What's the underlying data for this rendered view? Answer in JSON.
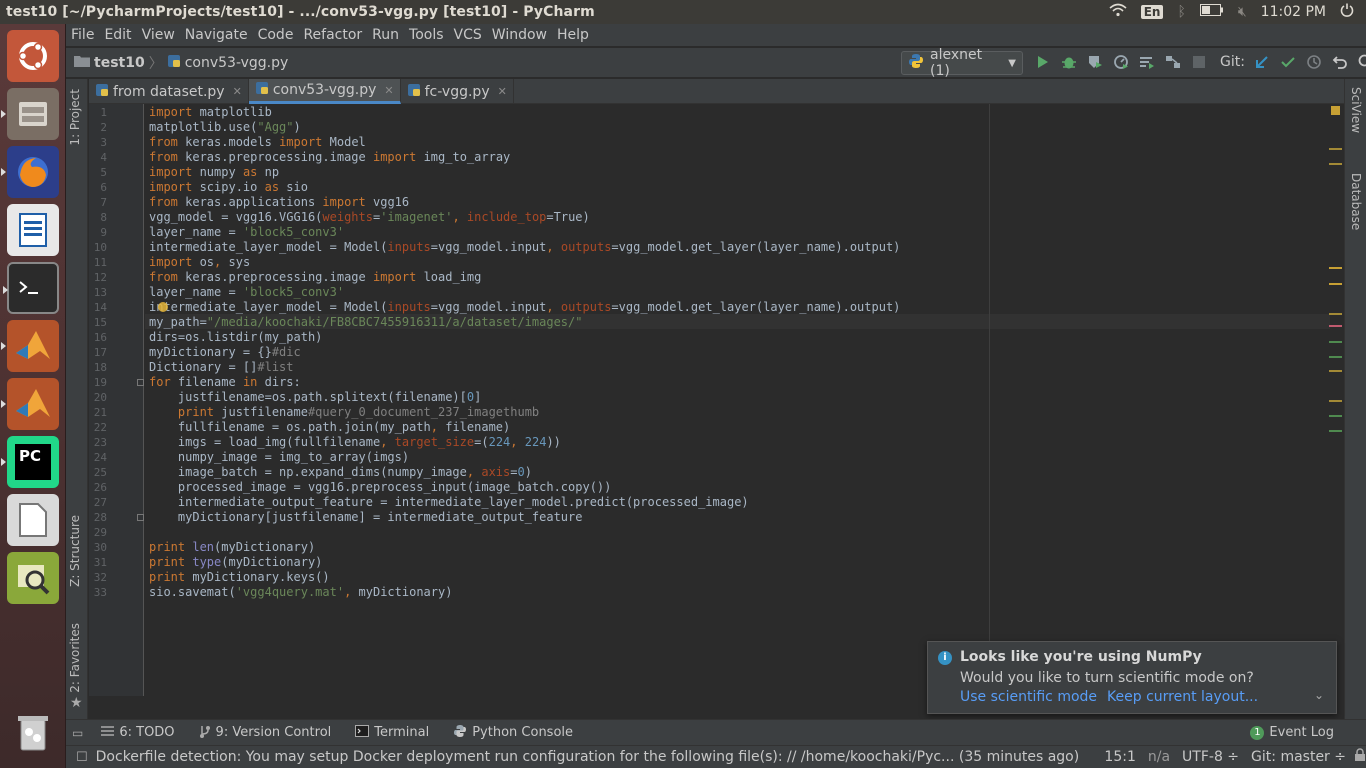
{
  "os": {
    "window_title": "test10 [~/PycharmProjects/test10] - .../conv53-vgg.py [test10] - PyCharm",
    "keyboard_lang": "En",
    "clock": "11:02 PM"
  },
  "launcher": {
    "items": [
      "ubuntu-dash-icon",
      "files-icon",
      "firefox-icon",
      "writer-icon",
      "terminal-icon",
      "matlab-icon",
      "matlab-icon",
      "pycharm-icon",
      "libreoffice-icon",
      "image-viewer-icon",
      "trash-icon"
    ]
  },
  "menu": [
    "File",
    "Edit",
    "View",
    "Navigate",
    "Code",
    "Refactor",
    "Run",
    "Tools",
    "VCS",
    "Window",
    "Help"
  ],
  "navbar": {
    "project": "test10",
    "file": "conv53-vgg.py",
    "run_config": "alexnet (1)",
    "git_label": "Git:"
  },
  "tabs": [
    {
      "label": "from dataset.py"
    },
    {
      "label": "conv53-vgg.py"
    },
    {
      "label": "fc-vgg.py"
    }
  ],
  "side_panels": {
    "left_top": "1: Project",
    "left_mid": "Z: Structure",
    "left_bottom": "2: Favorites",
    "right_top": "SciView",
    "right_mid": "Database"
  },
  "line_numbers": [
    "1",
    "2",
    "3",
    "4",
    "5",
    "6",
    "7",
    "8",
    "9",
    "10",
    "11",
    "12",
    "13",
    "14",
    "15",
    "16",
    "17",
    "18",
    "19",
    "20",
    "21",
    "22",
    "23",
    "24",
    "25",
    "26",
    "27",
    "28",
    "29",
    "30",
    "31",
    "32",
    "33"
  ],
  "code_lines": [
    "import matplotlib",
    "matplotlib.use(\"Agg\")",
    "from keras.models import Model",
    "from keras.preprocessing.image import img_to_array",
    "import numpy as np",
    "import scipy.io as sio",
    "from keras.applications import vgg16",
    "vgg_model = vgg16.VGG16(weights='imagenet', include_top=True)",
    "layer_name = 'block5_conv3'",
    "intermediate_layer_model = Model(inputs=vgg_model.input, outputs=vgg_model.get_layer(layer_name).output)",
    "import os, sys",
    "from keras.preprocessing.image import load_img",
    "layer_name = 'block5_conv3'",
    "intermediate_layer_model = Model(inputs=vgg_model.input, outputs=vgg_model.get_layer(layer_name).output)",
    "my_path=\"/media/koochaki/FB8CBC7455916311/a/dataset/images/\"",
    "dirs=os.listdir(my_path)",
    "myDictionary = {}#dic",
    "Dictionary = []#list",
    "for filename in dirs:",
    "    justfilename=os.path.splitext(filename)[0]",
    "    print justfilename#query_0_document_237_imagethumb",
    "    fullfilename = os.path.join(my_path, filename)",
    "    imgs = load_img(fullfilename, target_size=(224, 224))",
    "    numpy_image = img_to_array(imgs)",
    "    image_batch = np.expand_dims(numpy_image, axis=0)",
    "    processed_image = vgg16.preprocess_input(image_batch.copy())",
    "    intermediate_output_feature = intermediate_layer_model.predict(processed_image)",
    "    myDictionary[justfilename] = intermediate_output_feature",
    "",
    "print len(myDictionary)",
    "print type(myDictionary)",
    "print myDictionary.keys()",
    "sio.savemat('vgg4query.mat', myDictionary)"
  ],
  "notification": {
    "title": "Looks like you're using NumPy",
    "message": "Would you like to turn scientific mode on?",
    "action_primary": "Use scientific mode",
    "action_secondary": "Keep current layout..."
  },
  "bottom_tools": [
    {
      "label": "6: TODO",
      "icon": "todo-icon"
    },
    {
      "label": "9: Version Control",
      "icon": "vcs-icon"
    },
    {
      "label": "Terminal",
      "icon": "terminal-icon"
    },
    {
      "label": "Python Console",
      "icon": "python-console-icon"
    }
  ],
  "event_log": {
    "badge": "1",
    "label": "Event Log"
  },
  "status": {
    "message": "Dockerfile detection: You may setup Docker deployment run configuration for the following file(s): // /home/koochaki/Pyc... (35 minutes ago)",
    "position": "15:1",
    "na": "n/a",
    "encoding": "UTF-8 ÷",
    "git_branch": "Git: master ÷"
  },
  "colors": {
    "accent": "#4a88c7",
    "keyword": "#cc7832",
    "string": "#6a8759",
    "param": "#aa4926",
    "comment": "#808080",
    "link": "#589df6"
  }
}
